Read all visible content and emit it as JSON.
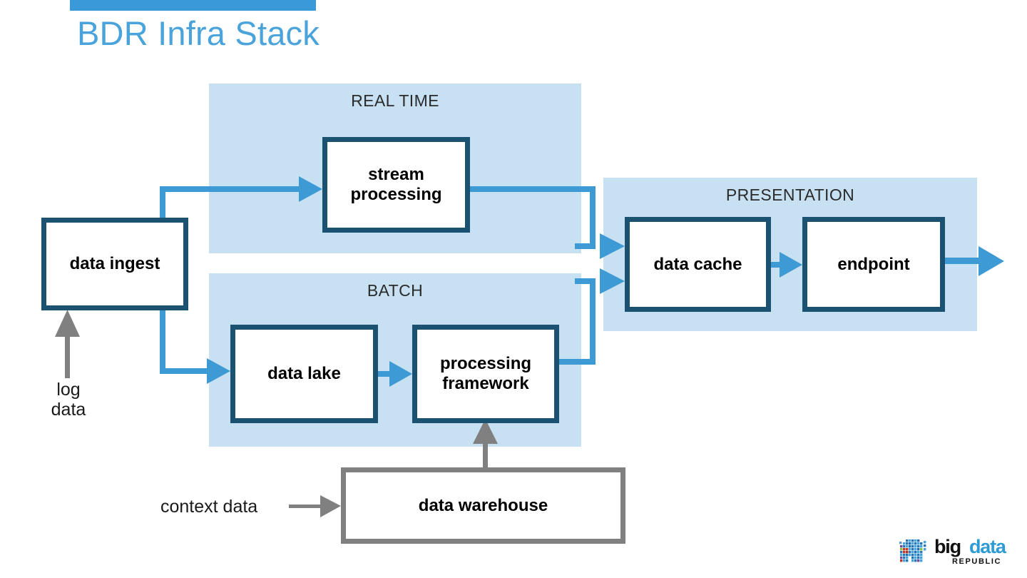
{
  "slide": {
    "title": "BDR Infra Stack",
    "accent_bar_color": "#3A9AD9",
    "title_color": "#4BA3DB",
    "background": "#FFFFFF"
  },
  "colors": {
    "zone_fill": "#C7E0F2",
    "box_border_navy": "#1B5271",
    "box_border_gray": "#808080",
    "arrow_blue": "#3D9AD5",
    "arrow_gray": "#808080",
    "box_fill": "#FFFFFF"
  },
  "zones": [
    {
      "id": "real-time",
      "label": "REAL TIME"
    },
    {
      "id": "batch",
      "label": "BATCH"
    },
    {
      "id": "presentation",
      "label": "PRESENTATION"
    }
  ],
  "boxes": [
    {
      "id": "data-ingest",
      "label": "data ingest",
      "style": "navy"
    },
    {
      "id": "stream-processing",
      "label": "stream\nprocessing",
      "style": "navy",
      "line1": "stream",
      "line2": "processing"
    },
    {
      "id": "data-lake",
      "label": "data lake",
      "style": "navy"
    },
    {
      "id": "processing-framework",
      "label": "processing\nframework",
      "style": "navy",
      "line1": "processing",
      "line2": "framework"
    },
    {
      "id": "data-cache",
      "label": "data cache",
      "style": "navy"
    },
    {
      "id": "endpoint",
      "label": "endpoint",
      "style": "navy"
    },
    {
      "id": "data-warehouse",
      "label": "data warehouse",
      "style": "gray"
    }
  ],
  "labels": {
    "log_data_line1": "log",
    "log_data_line2": "data",
    "context_data": "context data"
  },
  "connectors": [
    {
      "from": "log data",
      "to": "data ingest",
      "color": "gray"
    },
    {
      "from": "data ingest",
      "to": "stream processing",
      "color": "blue"
    },
    {
      "from": "data ingest",
      "to": "data lake",
      "color": "blue"
    },
    {
      "from": "stream processing",
      "to": "data cache",
      "color": "blue"
    },
    {
      "from": "data lake",
      "to": "processing framework",
      "color": "blue"
    },
    {
      "from": "processing framework",
      "to": "data cache",
      "color": "blue"
    },
    {
      "from": "data cache",
      "to": "endpoint",
      "color": "blue"
    },
    {
      "from": "endpoint",
      "to": "output",
      "color": "blue"
    },
    {
      "from": "context data",
      "to": "data warehouse",
      "color": "gray"
    },
    {
      "from": "data warehouse",
      "to": "processing framework",
      "color": "gray"
    }
  ],
  "logo": {
    "word_big": "big",
    "word_data": "data",
    "word_republic": "REPUBLIC",
    "icon": "pixel-elephant"
  }
}
